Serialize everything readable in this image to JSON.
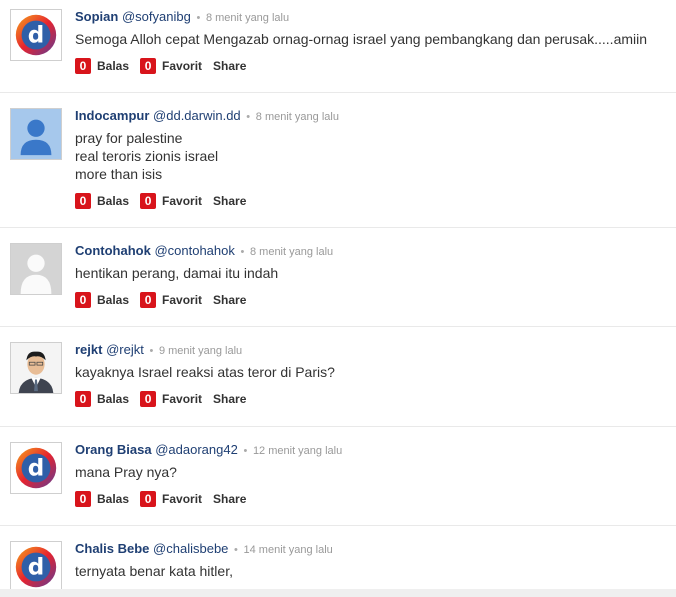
{
  "comments": [
    {
      "name": "Sopian",
      "handle": "@sofyanibg",
      "time": "8 menit yang lalu",
      "lines": [
        "Semoga Alloh cepat Mengazab ornag-ornag israel yang pembangkang dan perusak.....amiin"
      ],
      "reply_count": "0",
      "reply_label": "Balas",
      "fav_count": "0",
      "fav_label": "Favorit",
      "share_label": "Share",
      "avatar": "detik-logo-icon"
    },
    {
      "name": "Indocampur",
      "handle": "@dd.darwin.dd",
      "time": "8 menit yang lalu",
      "lines": [
        "pray for palestine",
        "real teroris zionis israel",
        "more than isis"
      ],
      "reply_count": "0",
      "reply_label": "Balas",
      "fav_count": "0",
      "fav_label": "Favorit",
      "share_label": "Share",
      "avatar": "default-user-blue-icon"
    },
    {
      "name": "Contohahok",
      "handle": "@contohahok",
      "time": "8 menit yang lalu",
      "lines": [
        "hentikan perang, damai itu indah"
      ],
      "reply_count": "0",
      "reply_label": "Balas",
      "fav_count": "0",
      "fav_label": "Favorit",
      "share_label": "Share",
      "avatar": "default-user-grey-icon"
    },
    {
      "name": "rejkt",
      "handle": "@rejkt",
      "time": "9 menit yang lalu",
      "lines": [
        "kayaknya Israel reaksi atas teror di Paris?"
      ],
      "reply_count": "0",
      "reply_label": "Balas",
      "fav_count": "0",
      "fav_label": "Favorit",
      "share_label": "Share",
      "avatar": "user-photo"
    },
    {
      "name": "Orang Biasa",
      "handle": "@adaorang42",
      "time": "12 menit yang lalu",
      "lines": [
        "mana Pray nya?"
      ],
      "reply_count": "0",
      "reply_label": "Balas",
      "fav_count": "0",
      "fav_label": "Favorit",
      "share_label": "Share",
      "avatar": "detik-logo-icon"
    },
    {
      "name": "Chalis Bebe",
      "handle": "@chalisbebe",
      "time": "14 menit yang lalu",
      "lines": [
        "ternyata benar kata hitler,"
      ],
      "avatar": "detik-logo-icon"
    }
  ],
  "separator": "•",
  "colors": {
    "name": "#1f3f73",
    "badge": "#d8141b",
    "time": "#999999"
  }
}
